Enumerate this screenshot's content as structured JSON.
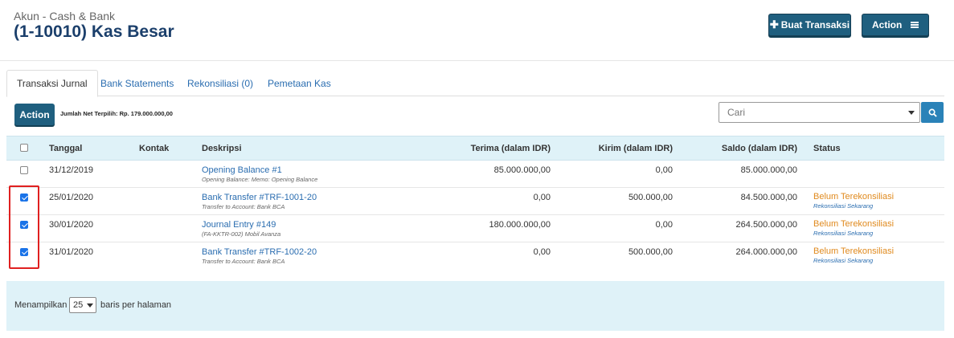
{
  "header": {
    "subtitle": "Akun - Cash & Bank",
    "title": "(1-10010) Kas Besar",
    "buat_transaksi_label": "Buat Transaksi",
    "action_label": "Action"
  },
  "tabs": [
    {
      "label": "Transaksi Jurnal",
      "active": true
    },
    {
      "label": "Bank Statements",
      "active": false
    },
    {
      "label": "Rekonsiliasi (0)",
      "active": false
    },
    {
      "label": "Pemetaan Kas",
      "active": false
    }
  ],
  "toolbar": {
    "action_label": "Action",
    "net_selected_text": "Jumlah Net Terpilih: Rp. 179.000.000,00",
    "search_placeholder": "Cari"
  },
  "table": {
    "headers": {
      "tanggal": "Tanggal",
      "kontak": "Kontak",
      "deskripsi": "Deskripsi",
      "terima": "Terima (dalam IDR)",
      "kirim": "Kirim (dalam IDR)",
      "saldo": "Saldo (dalam IDR)",
      "status": "Status"
    },
    "rows": [
      {
        "checked": false,
        "tanggal": "31/12/2019",
        "kontak": "",
        "deskripsi": "Opening Balance #1",
        "memo": "Opening Balance: Memo: Opening Balance",
        "terima": "85.000.000,00",
        "kirim": "0,00",
        "saldo": "85.000.000,00",
        "status": "",
        "status_link": ""
      },
      {
        "checked": true,
        "tanggal": "25/01/2020",
        "kontak": "",
        "deskripsi": "Bank Transfer #TRF-1001-20",
        "memo": "Transfer to Account: Bank BCA",
        "terima": "0,00",
        "kirim": "500.000,00",
        "saldo": "84.500.000,00",
        "status": "Belum Terekonsiliasi",
        "status_link": "Rekonsiliasi Sekarang"
      },
      {
        "checked": true,
        "tanggal": "30/01/2020",
        "kontak": "",
        "deskripsi": "Journal Entry #149",
        "memo": "(FA-KKTR-002) Mobil Avanza",
        "terima": "180.000.000,00",
        "kirim": "0,00",
        "saldo": "264.500.000,00",
        "status": "Belum Terekonsiliasi",
        "status_link": "Rekonsiliasi Sekarang"
      },
      {
        "checked": true,
        "tanggal": "31/01/2020",
        "kontak": "",
        "deskripsi": "Bank Transfer #TRF-1002-20",
        "memo": "Transfer to Account: Bank BCA",
        "terima": "0,00",
        "kirim": "500.000,00",
        "saldo": "264.000.000,00",
        "status": "Belum Terekonsiliasi",
        "status_link": "Rekonsiliasi Sekarang"
      }
    ]
  },
  "footer": {
    "prefix": "Menampilkan",
    "per_page": "25",
    "suffix": "baris per halaman"
  },
  "colors": {
    "primary_button": "#1f5f7f",
    "link": "#2a6db0",
    "status_warning": "#e08a1e",
    "table_header_bg": "#dff2f8",
    "highlight_border": "#e02020"
  }
}
